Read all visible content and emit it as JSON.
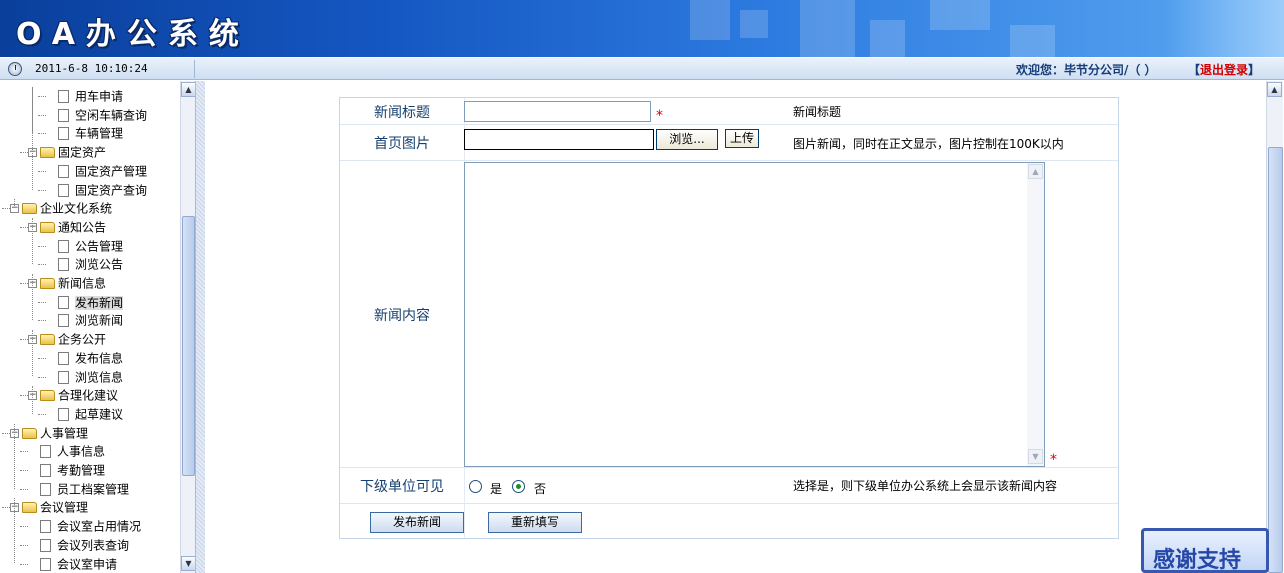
{
  "header": {
    "app_title": "OA办公系统"
  },
  "status": {
    "datetime": "2011-6-8 10:10:24",
    "welcome": "欢迎您：毕节分公司/（ ）",
    "logout_open": "【",
    "logout_label": "退出登录",
    "logout_close": "】"
  },
  "sidebar": {
    "nodes": [
      {
        "label": "用车申请",
        "type": "doc",
        "level": 2
      },
      {
        "label": "空闲车辆查询",
        "type": "doc",
        "level": 2
      },
      {
        "label": "车辆管理",
        "type": "doc",
        "level": 2
      },
      {
        "label": "固定资产",
        "type": "folder",
        "level": 1
      },
      {
        "label": "固定资产管理",
        "type": "doc",
        "level": 2
      },
      {
        "label": "固定资产查询",
        "type": "doc",
        "level": 2
      },
      {
        "label": "企业文化系统",
        "type": "folder",
        "level": 0
      },
      {
        "label": "通知公告",
        "type": "folder",
        "level": 1
      },
      {
        "label": "公告管理",
        "type": "doc",
        "level": 2
      },
      {
        "label": "浏览公告",
        "type": "doc",
        "level": 2
      },
      {
        "label": "新闻信息",
        "type": "folder",
        "level": 1
      },
      {
        "label": "发布新闻",
        "type": "doc",
        "level": 2,
        "selected": true
      },
      {
        "label": "浏览新闻",
        "type": "doc",
        "level": 2
      },
      {
        "label": "企务公开",
        "type": "folder",
        "level": 1
      },
      {
        "label": "发布信息",
        "type": "doc",
        "level": 2
      },
      {
        "label": "浏览信息",
        "type": "doc",
        "level": 2
      },
      {
        "label": "合理化建议",
        "type": "folder",
        "level": 1
      },
      {
        "label": "起草建议",
        "type": "doc",
        "level": 2
      },
      {
        "label": "人事管理",
        "type": "folder",
        "level": 0
      },
      {
        "label": "人事信息",
        "type": "doc",
        "level": 1
      },
      {
        "label": "考勤管理",
        "type": "doc",
        "level": 1
      },
      {
        "label": "员工档案管理",
        "type": "doc",
        "level": 1
      },
      {
        "label": "会议管理",
        "type": "folder",
        "level": 0
      },
      {
        "label": "会议室占用情况",
        "type": "doc",
        "level": 1
      },
      {
        "label": "会议列表查询",
        "type": "doc",
        "level": 1
      },
      {
        "label": "会议室申请",
        "type": "doc",
        "level": 1
      }
    ]
  },
  "form": {
    "title_label": "新闻标题",
    "title_value": "",
    "title_hint": "新闻标题",
    "image_label": "首页图片",
    "browse_button": "浏览...",
    "upload_button": "上传",
    "image_hint": "图片新闻，同时在正文显示，图片控制在100K以内",
    "content_label": "新闻内容",
    "content_value": "",
    "visible_label": "下级单位可见",
    "option_yes": "是",
    "option_no": "否",
    "selected_option": "否",
    "visible_hint": "选择是，则下级单位办公系统上会显示该新闻内容",
    "required_mark": "*",
    "submit_button": "发布新闻",
    "reset_button": "重新填写"
  },
  "badge": {
    "thanks": "感谢支持"
  },
  "colors": {
    "banner": "#1557c2",
    "logout": "#d00000",
    "label_text": "#16406f",
    "required": "#dd0000"
  }
}
